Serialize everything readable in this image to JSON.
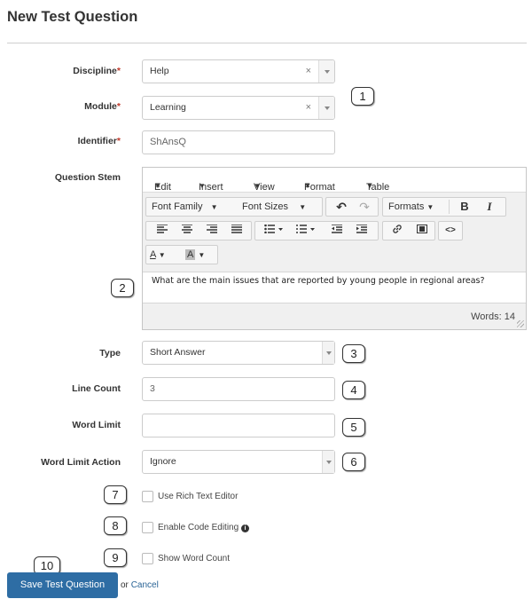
{
  "page": {
    "title": "New Test Question"
  },
  "form": {
    "discipline": {
      "label": "Discipline",
      "required_mark": "*",
      "value": "Help",
      "clear": "×"
    },
    "module": {
      "label": "Module",
      "required_mark": "*",
      "value": "Learning",
      "clear": "×"
    },
    "identifier": {
      "label": "Identifier",
      "required_mark": "*",
      "value": "ShAnsQ"
    },
    "question_stem": {
      "label": "Question Stem",
      "menu": [
        "Edit",
        "Insert",
        "View",
        "Format",
        "Table"
      ],
      "toolbar": {
        "font_family": "Font Family",
        "font_sizes": "Font Sizes",
        "formats": "Formats",
        "bold": "B",
        "italic": "I",
        "text_color": "A",
        "bg_color": "A"
      },
      "content": "What are the main issues that are reported by young people in regional areas?",
      "word_count": "Words: 14"
    },
    "type": {
      "label": "Type",
      "value": "Short Answer"
    },
    "line_count": {
      "label": "Line Count",
      "value": "3"
    },
    "word_limit": {
      "label": "Word Limit",
      "value": ""
    },
    "word_limit_action": {
      "label": "Word Limit Action",
      "value": "Ignore"
    },
    "use_rich_text": {
      "label": "Use Rich Text Editor",
      "checked": false
    },
    "enable_code": {
      "label": "Enable Code Editing",
      "checked": false,
      "info_icon": "i"
    },
    "show_word_count": {
      "label": "Show Word Count",
      "checked": false
    }
  },
  "actions": {
    "save": "Save Test Question",
    "or": "or",
    "cancel": "Cancel"
  },
  "callouts": [
    "1",
    "2",
    "3",
    "4",
    "5",
    "6",
    "7",
    "8",
    "9",
    "10"
  ]
}
